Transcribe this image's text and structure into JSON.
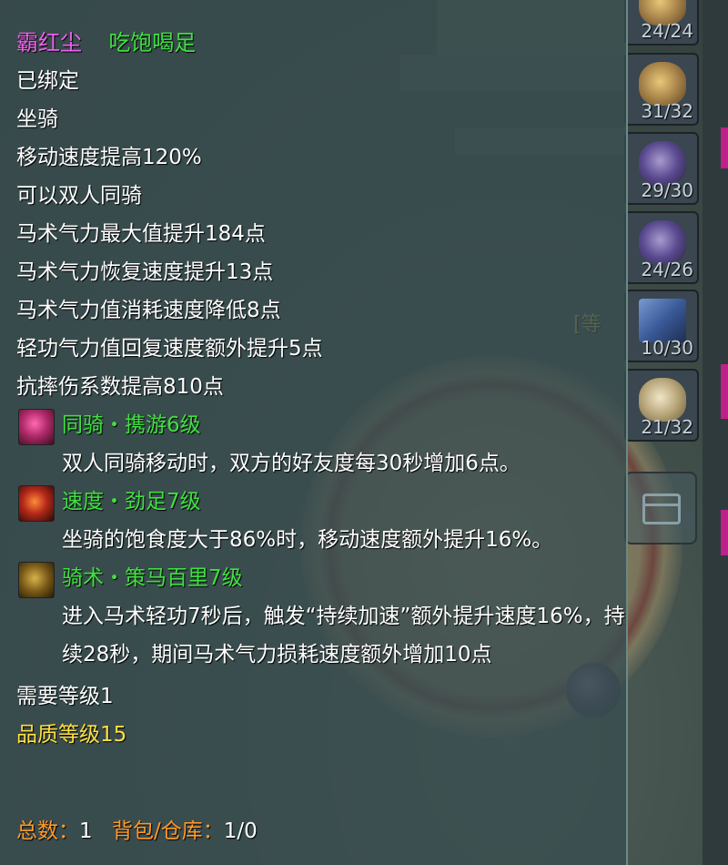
{
  "item": {
    "name": "霸红尘",
    "status": "吃饱喝足",
    "bound": "已绑定",
    "type": "坐骑",
    "attributes": [
      "移动速度提高120%",
      "可以双人同骑",
      "马术气力最大值提升184点",
      "马术气力恢复速度提升13点",
      "马术气力值消耗速度降低8点",
      "轻功气力值回复速度额外提升5点",
      "抗摔伤系数提高810点"
    ],
    "skills": [
      {
        "icon": "heart-icon",
        "name": "同骑・携游6级",
        "desc": "双人同骑移动时，双方的好友度每30秒增加6点。"
      },
      {
        "icon": "flame-icon",
        "name": "速度・劲足7级",
        "desc": "坐骑的饱食度大于86%时，移动速度额外提升16%。"
      },
      {
        "icon": "horse-icon",
        "name": "骑术・策马百里7级",
        "desc": "进入马术轻功7秒后，触发“持续加速”额外提升速度16%，持续28秒，期间马术气力损耗速度额外增加10点"
      }
    ],
    "required_level": "需要等级1",
    "quality": "品质等级15"
  },
  "footer": {
    "total_label": "总数：",
    "total_value": "1",
    "storage_label": "背包/仓库：",
    "storage_value": "1/0"
  },
  "inventory": {
    "slots": [
      {
        "icon": "gold-bag-icon",
        "count": "24/24"
      },
      {
        "icon": "gold-bag-icon",
        "count": "31/32"
      },
      {
        "icon": "purple-bag-icon",
        "count": "29/30"
      },
      {
        "icon": "purple-bag-icon",
        "count": "24/26"
      },
      {
        "icon": "book-icon",
        "count": "10/30"
      },
      {
        "icon": "cloth-bag-icon",
        "count": "21/32"
      }
    ],
    "side_text": "[等"
  },
  "colors": {
    "name": "#f060f0",
    "status": "#40e040",
    "skill": "#40e040",
    "quality": "#ffe040",
    "footer_label": "#ff9a2a"
  }
}
